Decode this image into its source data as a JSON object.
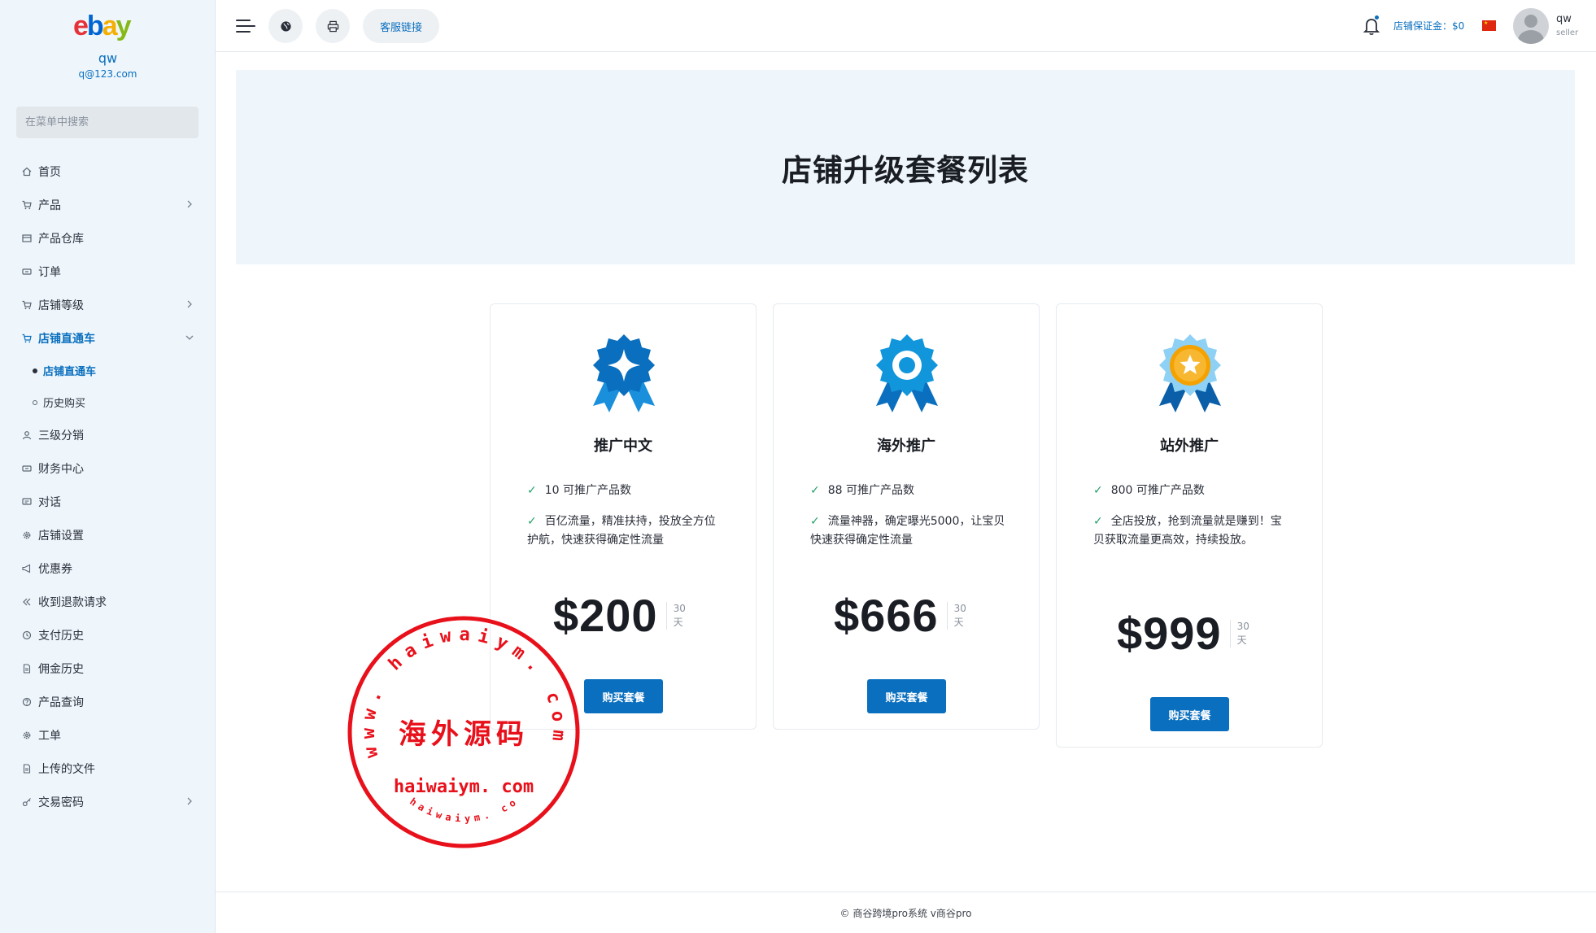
{
  "brand": {
    "logo_e": "e",
    "logo_b": "b",
    "logo_a": "a",
    "logo_y": "y"
  },
  "sidebar": {
    "user_name": "qw",
    "user_email": "q@123.com",
    "search_placeholder": "在菜单中搜索",
    "items": [
      {
        "label": "首页",
        "icon": "home-icon"
      },
      {
        "label": "产品",
        "icon": "cart-icon",
        "expandable": true
      },
      {
        "label": "产品仓库",
        "icon": "warehouse-icon"
      },
      {
        "label": "订单",
        "icon": "ticket-icon"
      },
      {
        "label": "店铺等级",
        "icon": "cart-icon",
        "expandable": true
      },
      {
        "label": "店铺直通车",
        "icon": "cart-icon",
        "expandable": true,
        "active": true
      },
      {
        "label": "三级分销",
        "icon": "user-icon"
      },
      {
        "label": "财务中心",
        "icon": "ticket-icon"
      },
      {
        "label": "对话",
        "icon": "chat-icon"
      },
      {
        "label": "店铺设置",
        "icon": "gear-icon"
      },
      {
        "label": "优惠券",
        "icon": "megaphone-icon"
      },
      {
        "label": "收到退款请求",
        "icon": "refund-icon"
      },
      {
        "label": "支付历史",
        "icon": "history-icon"
      },
      {
        "label": "佣金历史",
        "icon": "file-icon"
      },
      {
        "label": "产品查询",
        "icon": "question-icon"
      },
      {
        "label": "工单",
        "icon": "gear-icon"
      },
      {
        "label": "上传的文件",
        "icon": "file-icon"
      },
      {
        "label": "交易密码",
        "icon": "key-icon",
        "expandable": true
      }
    ],
    "sub_items": [
      {
        "label": "店铺直通车",
        "active": true
      },
      {
        "label": "历史购买",
        "active": false
      }
    ]
  },
  "header": {
    "kefu_label": "客服链接",
    "deposit_label": "店铺保证金：$0",
    "user_name": "qw",
    "user_role": "seller"
  },
  "banner": {
    "title": "店铺升级套餐列表"
  },
  "plans": [
    {
      "title": "推广中文",
      "feature1": "10 可推广产品数",
      "feature2": "百亿流量，精准扶持，投放全方位护航，快速获得确定性流量",
      "amount": "$200",
      "period_num": "30",
      "period_unit": "天",
      "button": "购买套餐",
      "medal_color": "#0a6fbe"
    },
    {
      "title": "海外推广",
      "feature1": "88 可推广产品数",
      "feature2": "流量神器，确定曝光5000，让宝贝快速获得确定性流量",
      "amount": "$666",
      "period_num": "30",
      "period_unit": "天",
      "button": "购买套餐",
      "medal_color": "#1296db"
    },
    {
      "title": "站外推广",
      "feature1": "800 可推广产品数",
      "feature2": "全店投放，抢到流量就是赚到！宝贝获取流量更高效，持续投放。",
      "amount": "$999",
      "period_num": "30",
      "period_unit": "天",
      "button": "购买套餐",
      "medal_color": "#f5a200"
    }
  ],
  "footer": {
    "text": "© 商谷跨境pro系统 v商谷pro"
  },
  "watermark": {
    "center_text": "海外源码",
    "url_text": "haiwaiym. com",
    "ring_text_top": "www. haiwaiym. com",
    "ring_text_bottom": "haiwaiym. com"
  },
  "colors": {
    "accent": "#0a6fbe",
    "sidebar_bg": "#eef6fc",
    "check": "#22a06b",
    "stamp": "#e8101a"
  }
}
